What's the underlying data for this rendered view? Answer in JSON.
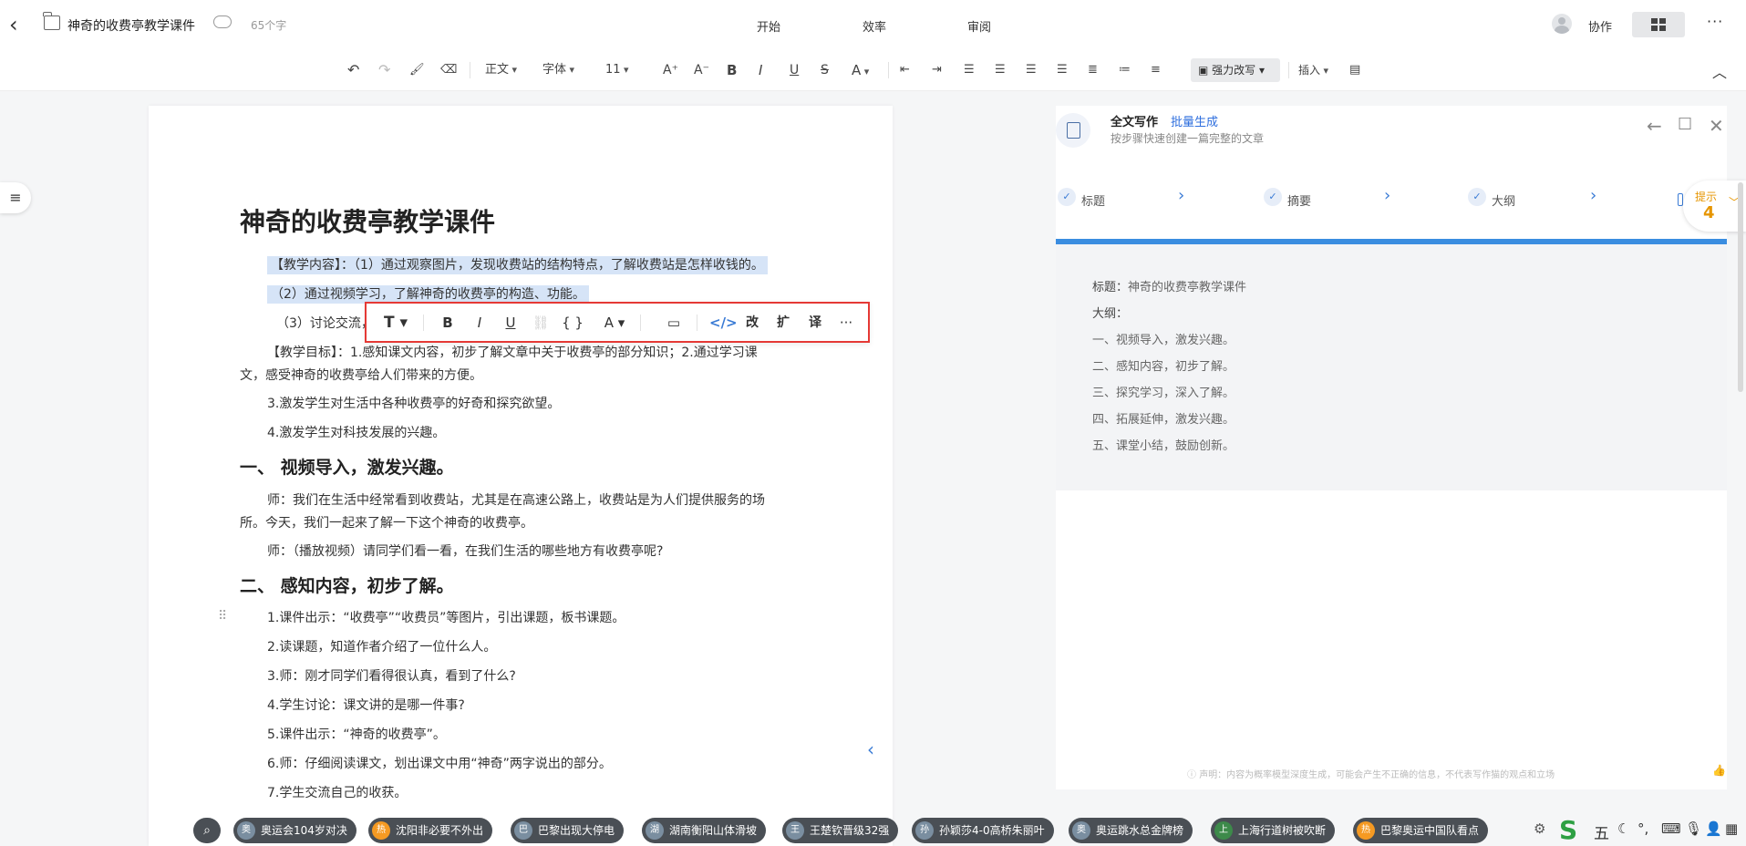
{
  "topbar": {
    "back_icon": "chevron-left-icon",
    "title": "神奇的收费亭教学课件",
    "word_count": "65个字",
    "tabs": [
      "开始",
      "效率",
      "审阅"
    ],
    "collab": "协作"
  },
  "toolbar": {
    "style": "正文",
    "font": "字体",
    "size": "11",
    "strong_rewrite": "强力改写",
    "insert": "插入"
  },
  "doc": {
    "title": "神奇的收费亭教学课件",
    "lines": [
      "【教学内容】：（1）通过观察图片，发现收费站的结构特点，了解收费站是怎样收钱的。",
      "（2）通过视频学习，了解神奇的收费亭的构造、功能。",
      "（3）讨论交流，",
      "【教学目标】：1.感知课文内容，初步了解文章中关于收费亭的部分知识；2.通过学习课",
      "文，感受神奇的收费亭给人们带来的方便。",
      "3.激发学生对生活中各种收费亭的好奇和探究欲望。",
      "4.激发学生对科技发展的兴趣。",
      "一、  视频导入，激发兴趣。",
      "师：我们在生活中经常看到收费站，尤其是在高速公路上，收费站是为人们提供服务的场",
      "所。今天，我们一起来了解一下这个神奇的收费亭。",
      "师：（播放视频）请同学们看一看，在我们生活的哪些地方有收费亭呢?",
      "二、  感知内容，初步了解。",
      "1.课件出示：“收费亭”“收费员”等图片，引出课题，板书课题。",
      "2.读课题，知道作者介绍了一位什么人。",
      "3.师：刚才同学们看得很认真，看到了什么?",
      "4.学生讨论：课文讲的是哪一件事?",
      "5.课件出示：“神奇的收费亭”。",
      "6.师：仔细阅读课文，划出课文中用“神奇”两字说出的部分。",
      "7.学生交流自己的收获。"
    ]
  },
  "float_toolbar": {
    "rewrite": "改",
    "expand": "扩",
    "translate": "译"
  },
  "panel": {
    "title": "全文写作",
    "batch": "批量生成",
    "subtitle": "按步骤快速创建一篇完整的文章",
    "steps": [
      "标题",
      "摘要",
      "大纲"
    ],
    "content_title_label": "标题：",
    "content_title": "神奇的收费亭教学课件",
    "outline_label": "大纲：",
    "outline": [
      "一、视频导入，激发兴趣。",
      "二、感知内容，初步了解。",
      "三、探究学习，深入了解。",
      "四、拓展延伸，激发兴趣。",
      "五、课堂小结，鼓励创新。"
    ],
    "disclaimer": "声明：内容为概率模型深度生成，可能会产生不正确的信息，不代表写作猫的观点和立场",
    "hint_label": "提示",
    "hint_count": "4"
  },
  "taskbar": {
    "news": [
      {
        "badge": "奥",
        "badge_color": "#7a8ea0",
        "text": "奥运会104岁对决"
      },
      {
        "badge": "热",
        "badge_color": "#f59a23",
        "text": "沈阳非必要不外出"
      },
      {
        "badge": "巴",
        "badge_color": "#7a8ea0",
        "text": "巴黎出现大停电"
      },
      {
        "badge": "湖",
        "badge_color": "#7a8ea0",
        "text": "湖南衡阳山体滑坡"
      },
      {
        "badge": "王",
        "badge_color": "#7a8ea0",
        "text": "王楚钦晋级32强"
      },
      {
        "badge": "孙",
        "badge_color": "#7a8ea0",
        "text": "孙颖莎4-0高桥朱丽叶"
      },
      {
        "badge": "奥",
        "badge_color": "#7a8ea0",
        "text": "奥运跳水总金牌榜"
      },
      {
        "badge": "上",
        "badge_color": "#3d8a4a",
        "text": "上海行道树被吹断"
      },
      {
        "badge": "热",
        "badge_color": "#f59a23",
        "text": "巴黎奥运中国队看点"
      }
    ],
    "ime": "五"
  }
}
